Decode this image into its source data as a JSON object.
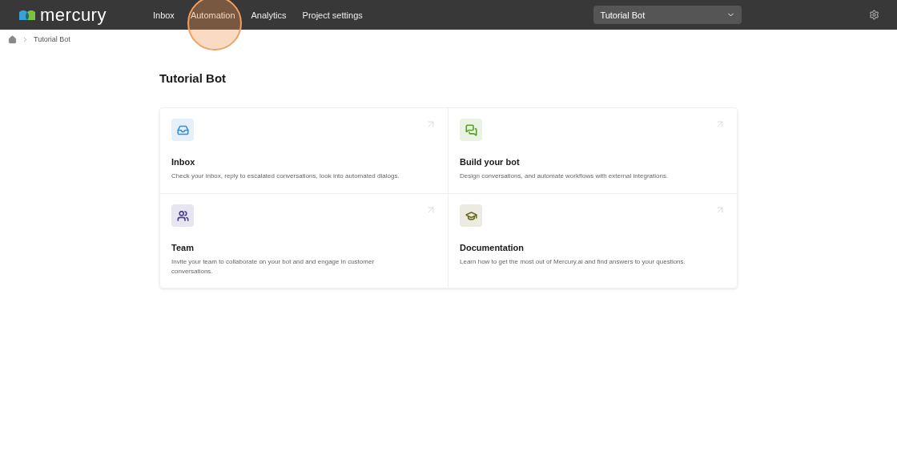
{
  "header": {
    "logo": "mercury",
    "nav": [
      {
        "label": "Inbox",
        "selected": false,
        "highlighted": false
      },
      {
        "label": "Automation",
        "selected": true,
        "highlighted": true
      },
      {
        "label": "Analytics",
        "selected": false,
        "highlighted": false
      },
      {
        "label": "Project settings",
        "selected": false,
        "highlighted": false
      }
    ],
    "bot_select": {
      "value": "Tutorial Bot"
    }
  },
  "breadcrumb": [
    "Tutorial Bot"
  ],
  "title": "Tutorial Bot",
  "cards": [
    {
      "kind": "inbox",
      "color": "#3a8fd0",
      "title": "Inbox",
      "description": "Check your inbox, reply to escalated conversations, look into automated dialogs."
    },
    {
      "kind": "chat",
      "color": "#5a9e2e",
      "title": "Build your bot",
      "description": "Design conversations, and automate workflows with external integrations."
    },
    {
      "kind": "team",
      "color": "#4b3f8a",
      "title": "Team",
      "description": "Invite your team to collaborate on your bot and and engage in customer conversations."
    },
    {
      "kind": "docs",
      "color": "#6b6b1e",
      "title": "Documentation",
      "description": "Learn how to get the most out of Mercury.ai and find answers to your questions."
    }
  ]
}
